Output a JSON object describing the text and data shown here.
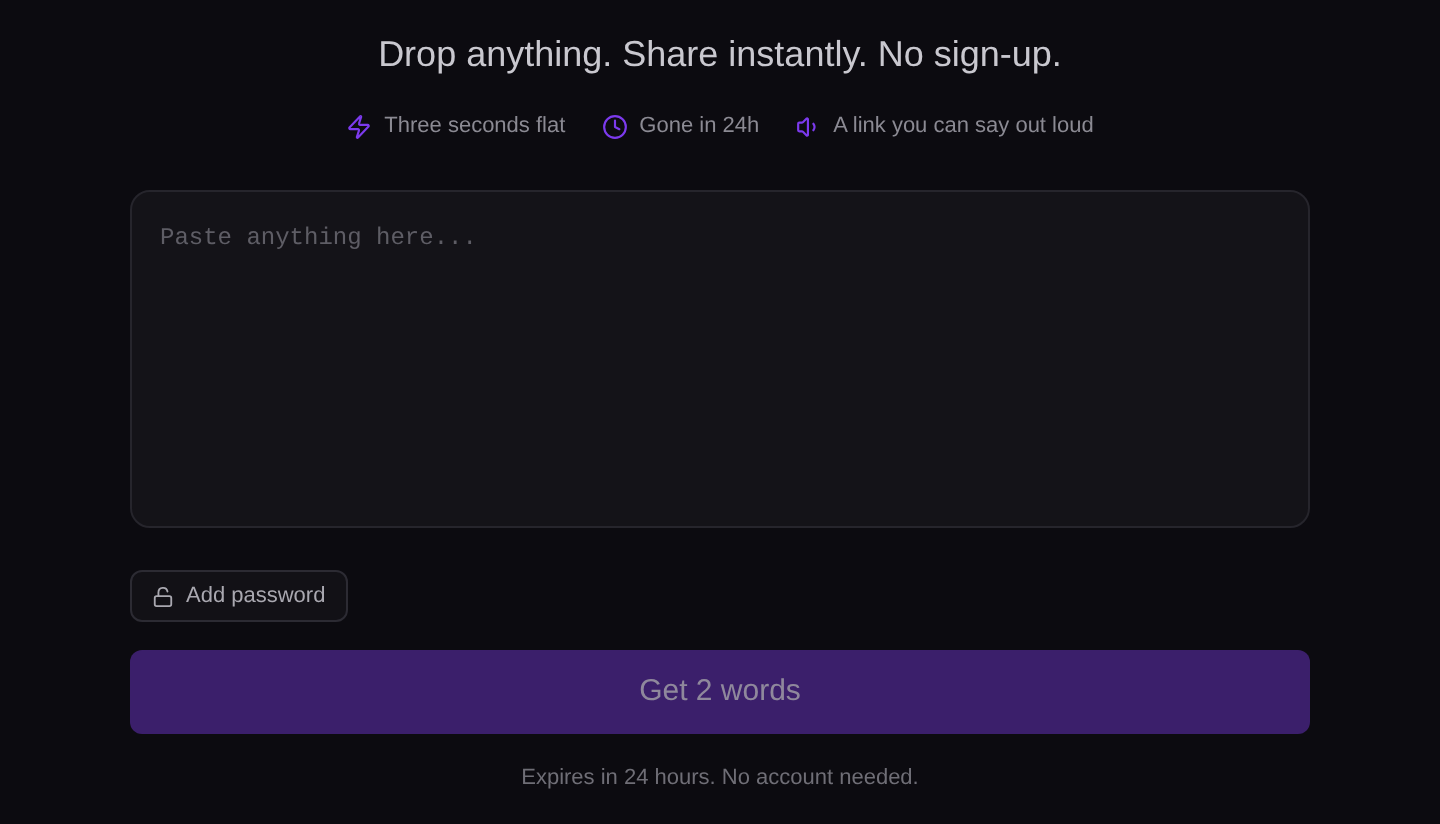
{
  "headline": "Drop anything. Share instantly. No sign-up.",
  "features": [
    {
      "kind": "bolt",
      "label": "Three seconds flat"
    },
    {
      "kind": "clock",
      "label": "Gone in 24h"
    },
    {
      "kind": "speaker",
      "label": "A link you can say out loud"
    }
  ],
  "paste_field": {
    "placeholder": "Paste anything here..."
  },
  "password_button": {
    "label": "Add password"
  },
  "submit_button": {
    "label": "Get 2 words",
    "disabled": true
  },
  "footnote": "Expires in 24 hours. No account needed."
}
